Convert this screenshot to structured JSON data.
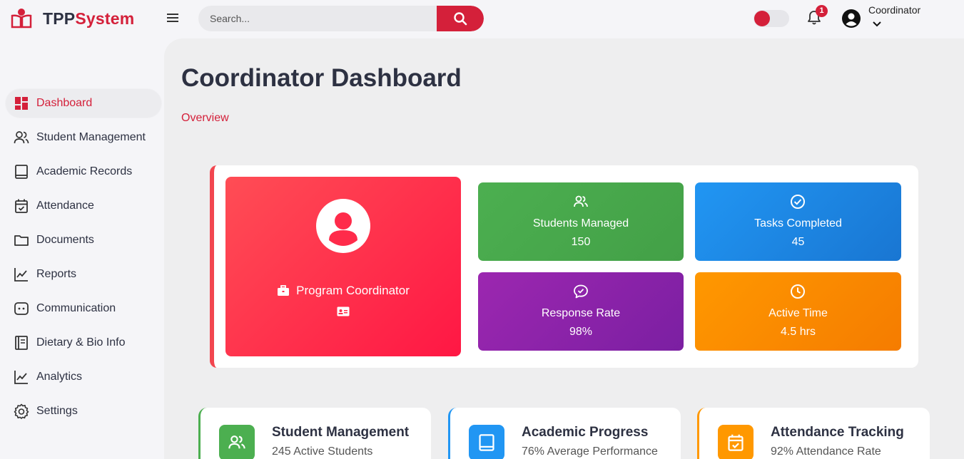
{
  "header": {
    "logo_prefix": "TPP",
    "logo_accent": "System",
    "search_placeholder": "Search...",
    "notification_count": "1",
    "user_name": "Coordinator"
  },
  "sidebar": {
    "items": [
      {
        "label": "Dashboard",
        "icon": "dashboard-icon",
        "active": true
      },
      {
        "label": "Student Management",
        "icon": "users-icon"
      },
      {
        "label": "Academic Records",
        "icon": "book-icon"
      },
      {
        "label": "Attendance",
        "icon": "calendar-check-icon"
      },
      {
        "label": "Documents",
        "icon": "folder-icon"
      },
      {
        "label": "Reports",
        "icon": "chart-line-icon"
      },
      {
        "label": "Communication",
        "icon": "chat-icon"
      },
      {
        "label": "Dietary & Bio Info",
        "icon": "notebook-icon"
      },
      {
        "label": "Analytics",
        "icon": "chart-line-icon"
      },
      {
        "label": "Settings",
        "icon": "gear-icon"
      }
    ]
  },
  "main": {
    "title": "Coordinator Dashboard",
    "breadcrumb": "Overview",
    "profile": {
      "role": "Program Coordinator"
    },
    "stats": [
      {
        "label": "Students Managed",
        "value": "150",
        "icon": "users-icon",
        "color": "#4caf50"
      },
      {
        "label": "Tasks Completed",
        "value": "45",
        "icon": "check-circle-icon",
        "color": "#2196f3"
      },
      {
        "label": "Response Rate",
        "value": "98%",
        "icon": "chat-check-icon",
        "color": "#9c27b0"
      },
      {
        "label": "Active Time",
        "value": "4.5 hrs",
        "icon": "clock-icon",
        "color": "#ff9800"
      }
    ],
    "features": [
      {
        "title": "Student Management",
        "subtitle": "245 Active Students",
        "icon": "users-icon",
        "color": "#4caf50"
      },
      {
        "title": "Academic Progress",
        "subtitle": "76% Average Performance",
        "icon": "book-icon",
        "color": "#2196f3"
      },
      {
        "title": "Attendance Tracking",
        "subtitle": "92% Attendance Rate",
        "icon": "calendar-check-icon",
        "color": "#ff9800"
      }
    ]
  },
  "colors": {
    "accent": "#d4203a",
    "profile_gradient_start": "#ff4d55",
    "profile_gradient_end": "#ff1744"
  }
}
